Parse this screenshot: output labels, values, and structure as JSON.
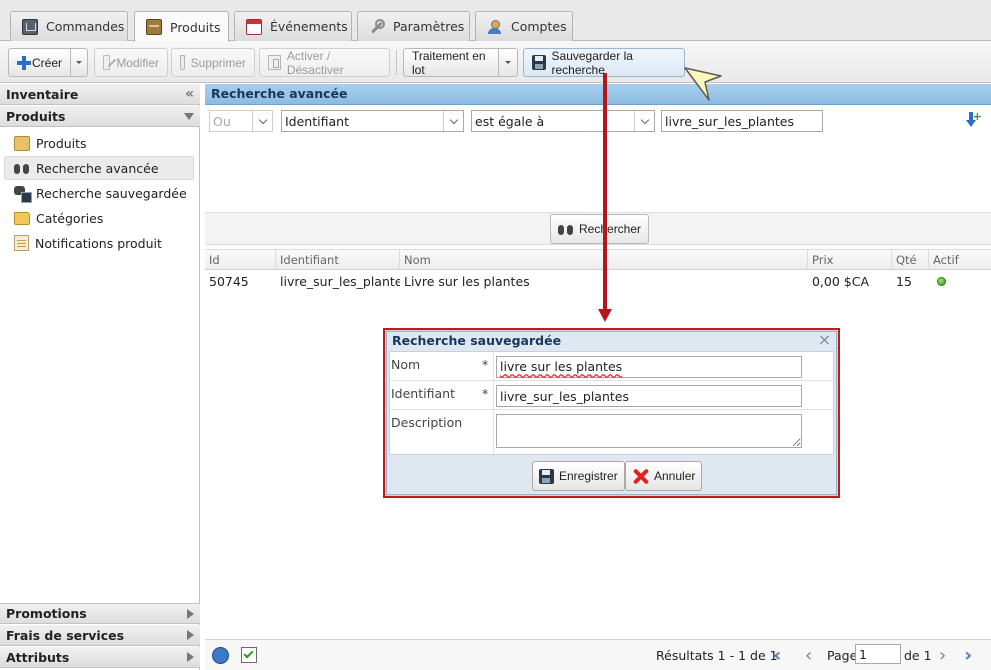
{
  "tabs": [
    {
      "label": "Commandes",
      "icon": "orders-icon",
      "active": false
    },
    {
      "label": "Produits",
      "icon": "products-icon",
      "active": true
    },
    {
      "label": "Événements",
      "icon": "events-icon",
      "active": false
    },
    {
      "label": "Paramètres",
      "icon": "settings-icon",
      "active": false
    },
    {
      "label": "Comptes",
      "icon": "accounts-icon",
      "active": false
    }
  ],
  "toolbar": {
    "create": "Créer",
    "edit": "Modifier",
    "delete": "Supprimer",
    "toggle": "Activer / Désactiver",
    "batch": "Traitement en lot",
    "save_search": "Sauvegarder la recherche"
  },
  "sidebar": {
    "inventory_header": "Inventaire",
    "products_header": "Produits",
    "items": [
      {
        "label": "Produits",
        "icon": "product-box-icon"
      },
      {
        "label": "Recherche avancée",
        "icon": "binoculars-icon",
        "selected": true
      },
      {
        "label": "Recherche sauvegardée",
        "icon": "saved-search-icon"
      },
      {
        "label": "Catégories",
        "icon": "folder-icon"
      },
      {
        "label": "Notifications produit",
        "icon": "notification-icon"
      }
    ],
    "bottom_sections": [
      "Promotions",
      "Frais de services",
      "Attributs"
    ]
  },
  "advanced_search": {
    "title": "Recherche avancée",
    "criteria": {
      "logic": "Ou",
      "field": "Identifiant",
      "operator": "est égale à",
      "value": "livre_sur_les_plantes"
    },
    "search_button": "Rechercher"
  },
  "grid": {
    "columns": [
      "Id",
      "Identifiant",
      "Nom",
      "Prix",
      "Qté",
      "Actif"
    ],
    "rows": [
      {
        "id": "50745",
        "identifiant": "livre_sur_les_plantes",
        "nom": "Livre sur les plantes",
        "prix": "0,00 $CA",
        "qte": "15",
        "actif": true
      }
    ]
  },
  "status": {
    "results": "Résultats 1 - 1 de 1",
    "page_label": "Page",
    "page_value": "1",
    "of_label": "de 1"
  },
  "dialog": {
    "title": "Recherche sauvegardée",
    "name_label": "Nom",
    "name_value": "livre sur les plantes",
    "id_label": "Identifiant",
    "id_value": "livre_sur_les_plantes",
    "desc_label": "Description",
    "desc_value": "",
    "required_mark": "*",
    "save_button": "Enregistrer",
    "cancel_button": "Annuler"
  },
  "colors": {
    "accent_blue": "#8cbbe1",
    "highlight_red": "#c21a1a",
    "active_green": "#2e9a19"
  }
}
